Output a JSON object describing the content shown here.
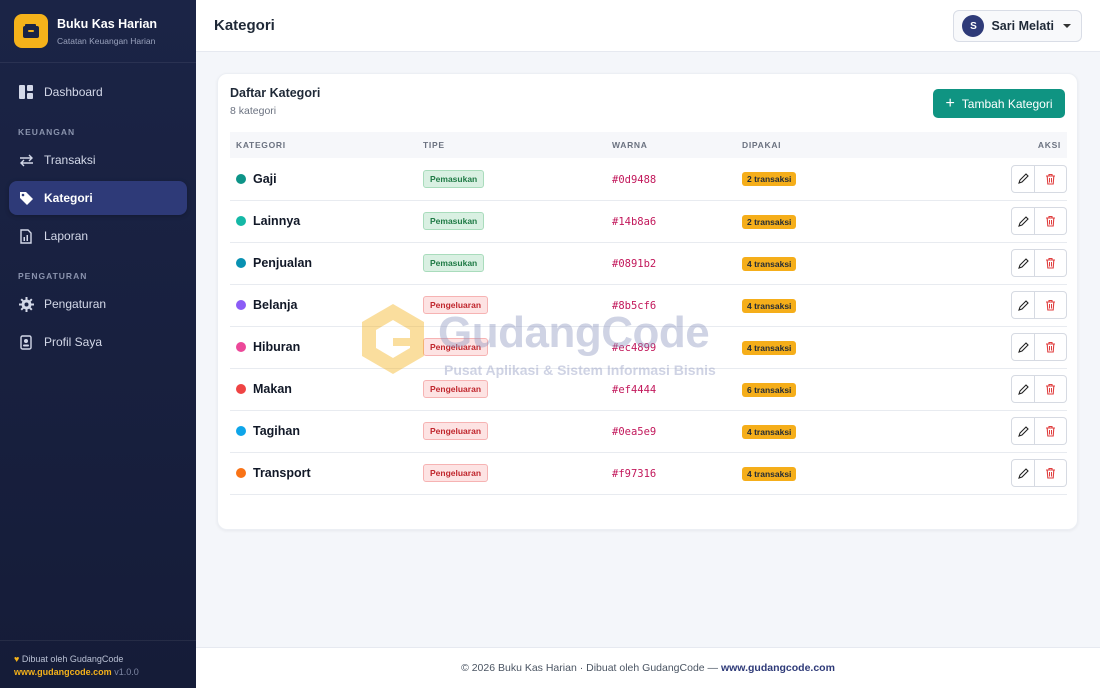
{
  "brand": {
    "title": "Buku Kas Harian",
    "subtitle": "Catatan Keuangan Harian"
  },
  "sidebar": {
    "items": [
      {
        "label": "Dashboard",
        "icon": "dashboard-icon"
      },
      {
        "label": "Transaksi",
        "icon": "arrows-swap-icon"
      },
      {
        "label": "Kategori",
        "icon": "tag-icon",
        "active": true
      },
      {
        "label": "Laporan",
        "icon": "report-icon"
      },
      {
        "label": "Pengaturan",
        "icon": "gear-icon"
      },
      {
        "label": "Profil Saya",
        "icon": "profile-icon"
      }
    ],
    "sections": {
      "keuangan": "KEUANGAN",
      "pengaturan": "PENGATURAN"
    },
    "footer": {
      "made_by": "Dibuat oleh GudangCode",
      "link": "www.gudangcode.com",
      "version": "v1.0.0"
    }
  },
  "header": {
    "title": "Kategori",
    "user": {
      "initial": "S",
      "name": "Sari Melati"
    }
  },
  "card": {
    "title": "Daftar Kategori",
    "count": "8 kategori",
    "add_button": "Tambah Kategori",
    "columns": [
      "KATEGORI",
      "TIPE",
      "WARNA",
      "DIPAKAI",
      "AKSI"
    ],
    "rows": [
      {
        "name": "Gaji",
        "type": "Pemasukan",
        "color": "#0d9488",
        "used": "2 transaksi"
      },
      {
        "name": "Lainnya",
        "type": "Pemasukan",
        "color": "#14b8a6",
        "used": "2 transaksi"
      },
      {
        "name": "Penjualan",
        "type": "Pemasukan",
        "color": "#0891b2",
        "used": "4 transaksi"
      },
      {
        "name": "Belanja",
        "type": "Pengeluaran",
        "color": "#8b5cf6",
        "used": "4 transaksi"
      },
      {
        "name": "Hiburan",
        "type": "Pengeluaran",
        "color": "#ec4899",
        "used": "4 transaksi"
      },
      {
        "name": "Makan",
        "type": "Pengeluaran",
        "color": "#ef4444",
        "used": "6 transaksi"
      },
      {
        "name": "Tagihan",
        "type": "Pengeluaran",
        "color": "#0ea5e9",
        "used": "4 transaksi"
      },
      {
        "name": "Transport",
        "type": "Pengeluaran",
        "color": "#f97316",
        "used": "4 transaksi"
      }
    ]
  },
  "watermark": {
    "name": "GudangCode",
    "tagline": "Pusat Aplikasi & Sistem Informasi Bisnis"
  },
  "footer": {
    "text": "© 2026 Buku Kas Harian · Dibuat oleh GudangCode —",
    "link": "www.gudangcode.com"
  },
  "colors": {
    "sidebar": "#1b2446",
    "active": "#2e3a78",
    "accent": "#0f9482",
    "brand": "#f5b21a"
  }
}
